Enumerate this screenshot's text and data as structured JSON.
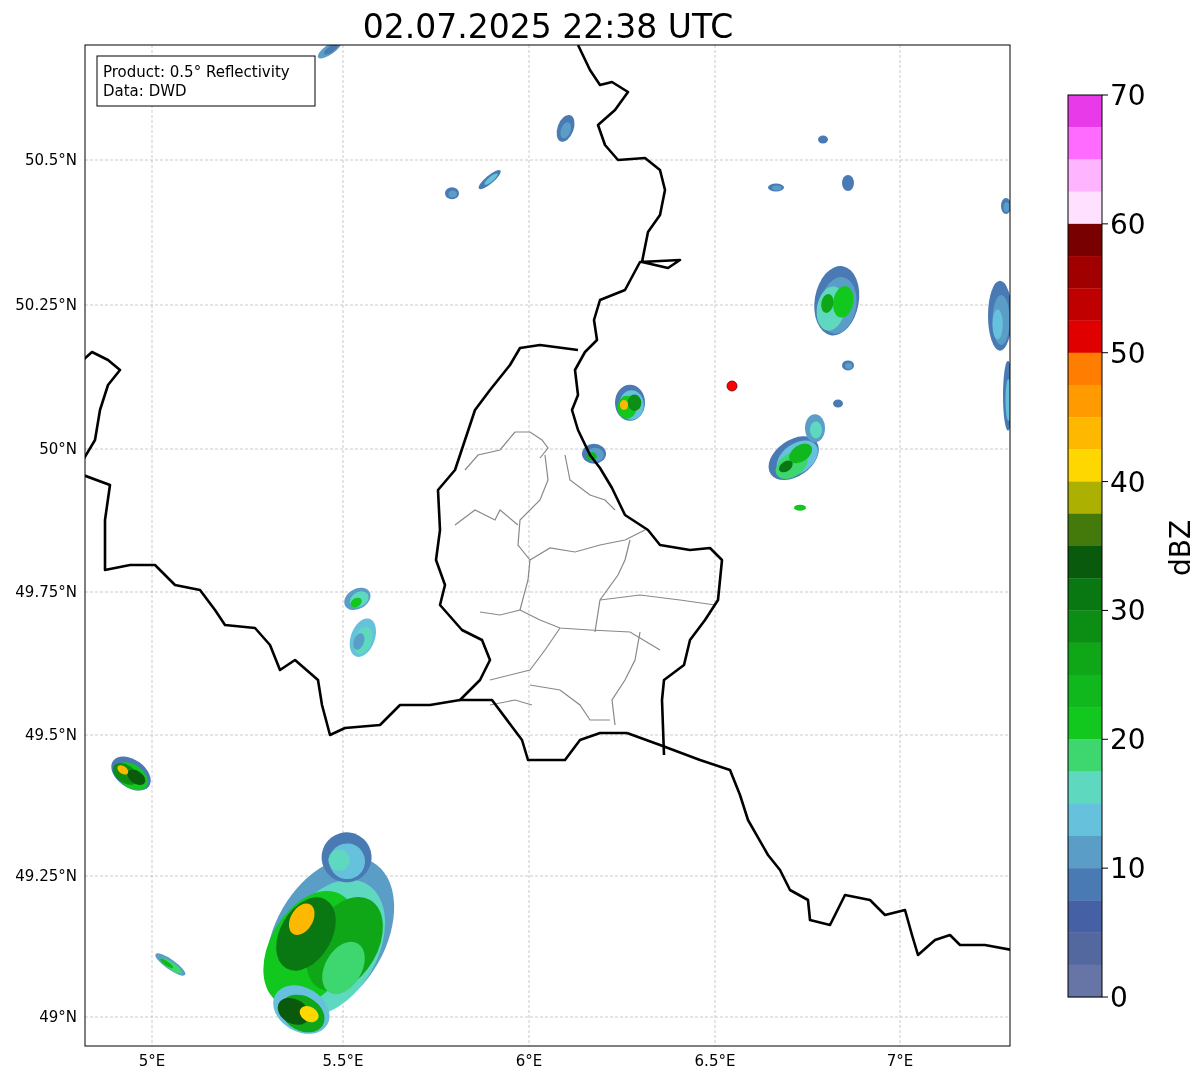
{
  "title": "02.07.2025 22:38 UTC",
  "info_box": {
    "lines": [
      "Product: 0.5° Reflectivity",
      "Data: DWD"
    ]
  },
  "lat_ticks": [
    "50.5°N",
    "50.25°N",
    "50°N",
    "49.75°N",
    "49.5°N",
    "49.25°N",
    "49°N"
  ],
  "lon_ticks": [
    "5°E",
    "5.5°E",
    "6°E",
    "6.5°E",
    "7°E"
  ],
  "colorbar": {
    "label": "dBZ",
    "ticks": [
      "70",
      "60",
      "50",
      "40",
      "30",
      "20",
      "10",
      "0"
    ],
    "bands": [
      {
        "color": "#e83ae8"
      },
      {
        "color": "#ff6aff"
      },
      {
        "color": "#ffb4ff"
      },
      {
        "color": "#ffe0ff"
      },
      {
        "color": "#780000"
      },
      {
        "color": "#a00000"
      },
      {
        "color": "#c00000"
      },
      {
        "color": "#e00000"
      },
      {
        "color": "#ff7d00"
      },
      {
        "color": "#ff9a00"
      },
      {
        "color": "#ffb800"
      },
      {
        "color": "#ffd700"
      },
      {
        "color": "#acb000"
      },
      {
        "color": "#447a0c"
      },
      {
        "color": "#0a5a0e"
      },
      {
        "color": "#0a7812"
      },
      {
        "color": "#0c8e14"
      },
      {
        "color": "#0fa618"
      },
      {
        "color": "#10b81e"
      },
      {
        "color": "#12c81e"
      },
      {
        "color": "#3ed66e"
      },
      {
        "color": "#5fd8c0"
      },
      {
        "color": "#66c2dc"
      },
      {
        "color": "#5a9ec8"
      },
      {
        "color": "#4a7ab4"
      },
      {
        "color": "#4560a4"
      },
      {
        "color": "#5468a0"
      },
      {
        "color": "#6674a6"
      }
    ]
  }
}
